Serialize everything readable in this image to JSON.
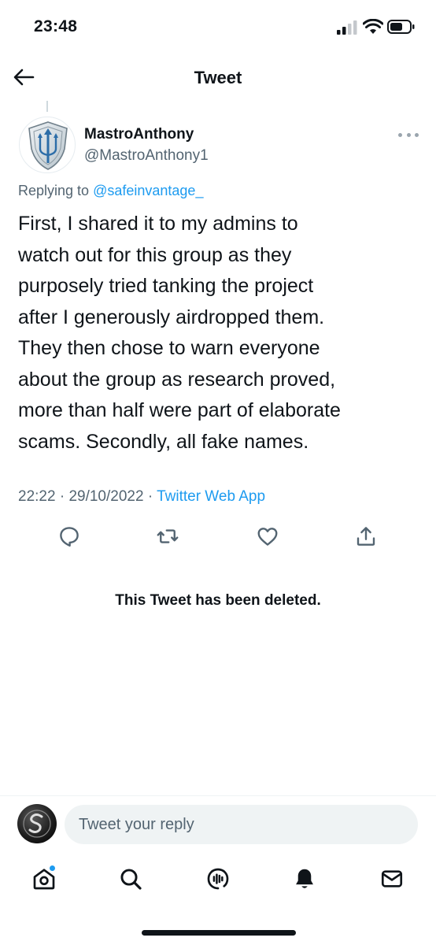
{
  "status_bar": {
    "time": "23:48"
  },
  "nav": {
    "title": "Tweet"
  },
  "tweet": {
    "author_name": "MastroAnthony",
    "author_handle": "@MastroAnthony1",
    "replying_prefix": "Replying to",
    "replying_to": "@safeinvantage_",
    "text": "First, I shared it to my admins to\nwatch out for this group as they\npurposely tried tanking the project\nafter I generously airdropped them.\nThey then chose to warn everyone\nabout the group as research proved,\nmore than half were part of elaborate\nscams. Secondly, all fake names.",
    "time": "22:22",
    "date": "29/10/2022",
    "separator": "·",
    "source": "Twitter Web App"
  },
  "actions": {
    "reply_icon": "reply-icon",
    "retweet_icon": "retweet-icon",
    "like_icon": "like-icon",
    "share_icon": "share-icon"
  },
  "deleted_notice": "This Tweet has been deleted.",
  "composer": {
    "placeholder": "Tweet your reply"
  },
  "tabbar": {
    "items": [
      "home-icon",
      "search-icon",
      "spaces-icon",
      "notifications-icon",
      "messages-icon"
    ],
    "home_has_badge": true
  },
  "colors": {
    "accent": "#1d9bf0",
    "secondary_text": "#536471",
    "text": "#0f1419"
  }
}
